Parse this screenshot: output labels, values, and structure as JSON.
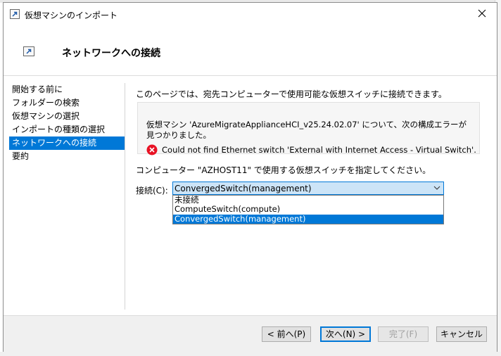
{
  "window": {
    "title": "仮想マシンのインポート"
  },
  "header": {
    "title": "ネットワークへの接続"
  },
  "nav": {
    "items": [
      {
        "label": "開始する前に"
      },
      {
        "label": "フォルダーの検索"
      },
      {
        "label": "仮想マシンの選択"
      },
      {
        "label": "インポートの種類の選択"
      },
      {
        "label": "ネットワークへの接続",
        "selected": true
      },
      {
        "label": "要約"
      }
    ]
  },
  "content": {
    "intro": "このページでは、宛先コンピューターで使用可能な仮想スイッチに接続できます。",
    "error_description": "仮想マシン 'AzureMigrateApplianceHCI_v25.24.02.07' について、次の構成エラーが見つかりました。",
    "error_message": "Could not find Ethernet switch 'External with Internet Access - Virtual Switch'.",
    "instruction": "コンピューター \"AZHOST11\" で使用する仮想スイッチを指定してください。",
    "connection_label": "接続(C):",
    "connection_value": "ConvergedSwitch(management)",
    "options": [
      "未接続",
      "ComputeSwitch(compute)",
      "ConvergedSwitch(management)"
    ]
  },
  "footer": {
    "back_label": "< 前へ(P)",
    "next_label": "次へ(N) >",
    "finish_label": "完了(F)",
    "cancel_label": "キャンセル"
  },
  "icons": {
    "app": "import-arrow-icon",
    "error": "error-x-circle-icon",
    "close": "close-icon",
    "dropdown": "chevron-down-icon"
  },
  "colors": {
    "selection": "#0078d7",
    "error": "#e81123",
    "select_background": "#cce4f7"
  }
}
